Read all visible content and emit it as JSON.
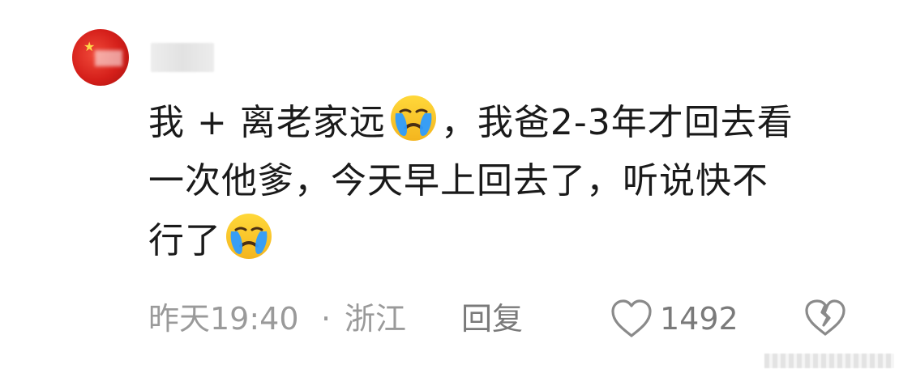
{
  "comment": {
    "lines": [
      [
        "我 + 离老家远",
        "，我爸2-3年才回去看"
      ],
      [
        "一次他爹，今天早上回去了，听说快不"
      ],
      [
        "行了"
      ]
    ],
    "emoji_name": "loudly-crying-face"
  },
  "meta": {
    "time": "昨天19:40",
    "separator": "·",
    "location": "浙江",
    "reply_label": "回复"
  },
  "actions": {
    "like_count": "1492"
  },
  "colors": {
    "text": "#1a1a1a",
    "meta": "#9a9a9a",
    "icon": "#8a8a8a"
  }
}
